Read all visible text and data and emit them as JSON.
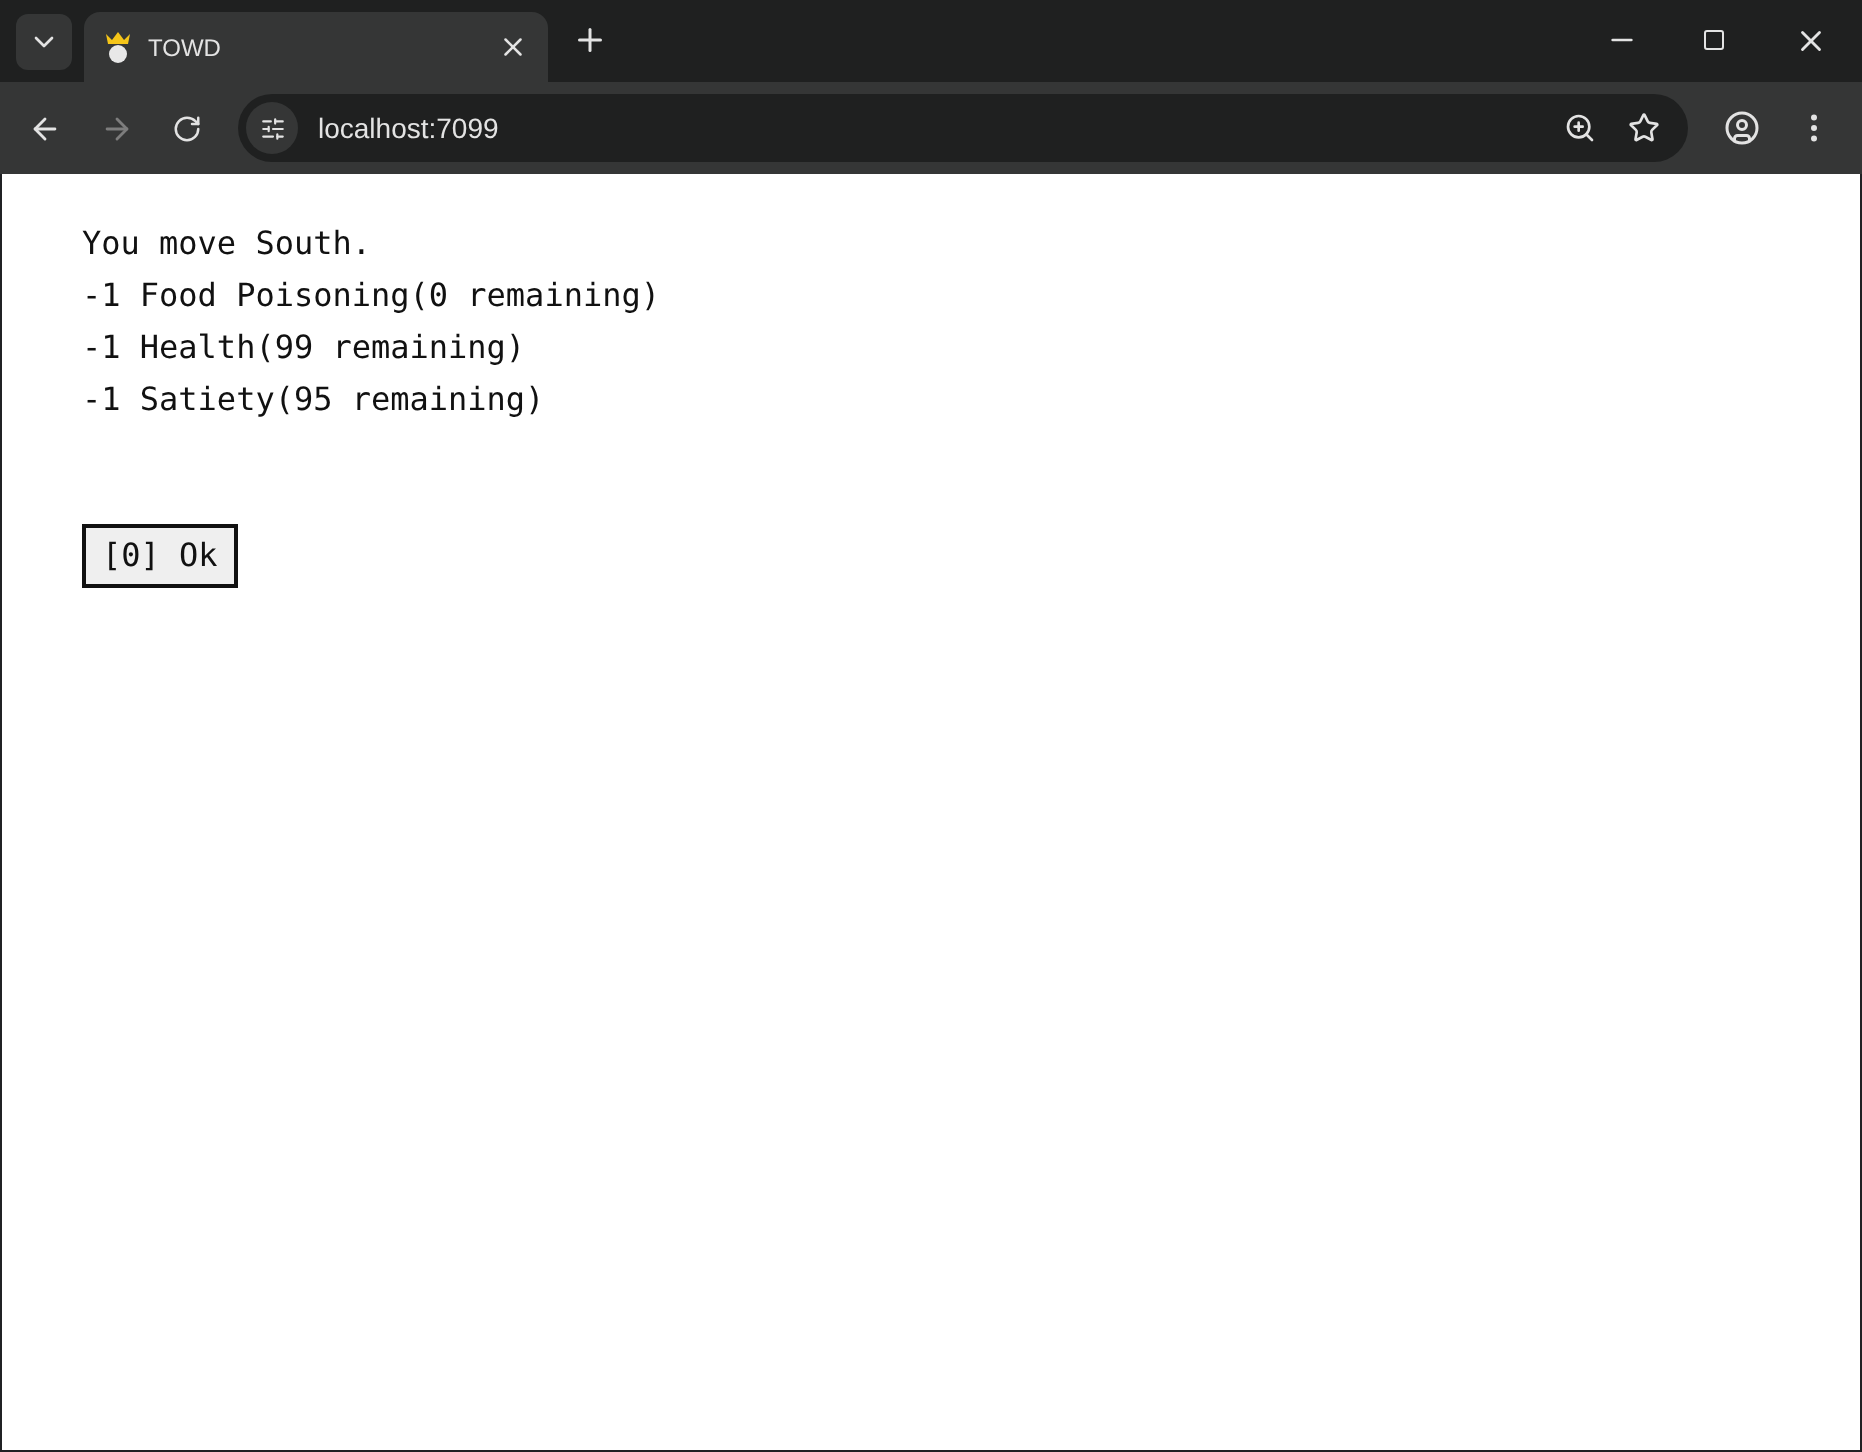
{
  "browser": {
    "tab_title": "TOWD",
    "address": "localhost:7099"
  },
  "messages": [
    "You move South.",
    "-1 Food Poisoning(0 remaining)",
    "-1 Health(99 remaining)",
    "-1 Satiety(95 remaining)"
  ],
  "buttons": [
    "[0] Ok"
  ]
}
